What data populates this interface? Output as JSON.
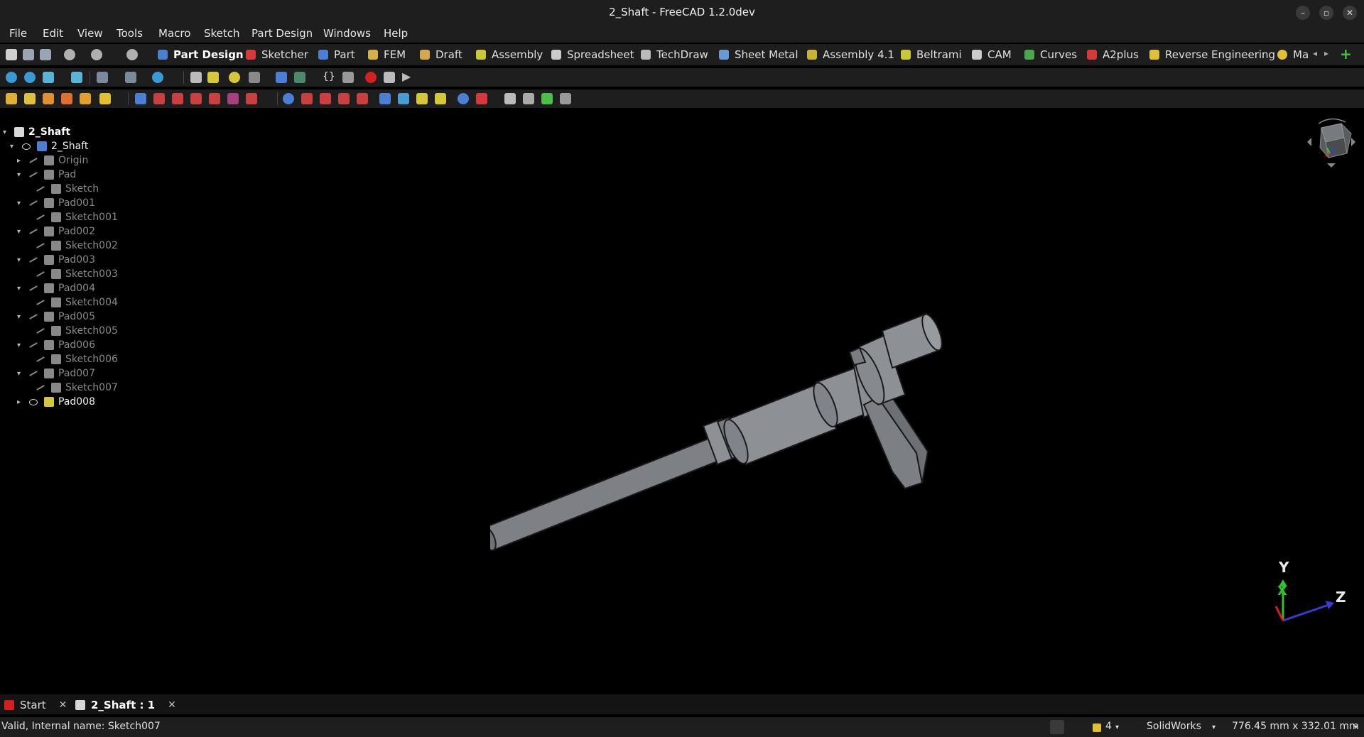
{
  "window": {
    "title": "2_Shaft - FreeCAD 1.2.0dev",
    "controls": [
      "–",
      "▫",
      "✕"
    ]
  },
  "menu": [
    "File",
    "Edit",
    "View",
    "Tools",
    "Macro",
    "Sketch",
    "Part Design",
    "Windows",
    "Help"
  ],
  "workbenches": [
    {
      "label": "Part Design",
      "color": "#4a7fd4",
      "active": true
    },
    {
      "label": "Sketcher",
      "color": "#d63a3a"
    },
    {
      "label": "Part",
      "color": "#4a7fd4"
    },
    {
      "label": "FEM",
      "color": "#d4b24a"
    },
    {
      "label": "Draft",
      "color": "#d4a94a"
    },
    {
      "label": "Assembly",
      "color": "#c8c83a"
    },
    {
      "label": "Spreadsheet",
      "color": "#cccccc"
    },
    {
      "label": "TechDraw",
      "color": "#bbbbbb"
    },
    {
      "label": "Sheet Metal",
      "color": "#6a9ad4"
    },
    {
      "label": "Assembly 4.1",
      "color": "#c8b23a"
    },
    {
      "label": "Beltrami",
      "color": "#c8c83a"
    },
    {
      "label": "CAM",
      "color": "#cccccc"
    },
    {
      "label": "Curves",
      "color": "#4aa84a"
    },
    {
      "label": "A2plus",
      "color": "#d43a3a"
    },
    {
      "label": "Reverse Engineering",
      "color": "#e0c03a"
    },
    {
      "label": "Ma",
      "color": "#e0c03a"
    }
  ],
  "tree": {
    "root": "2_Shaft",
    "items": [
      {
        "label": "2_Shaft",
        "level": 1,
        "arrow": "▾",
        "eye": "shown",
        "icon": "body-icon",
        "color": "#4a7fd4",
        "style": "bright"
      },
      {
        "label": "Origin",
        "level": 2,
        "arrow": "▸",
        "eye": "hidden",
        "icon": "origin-icon",
        "color": "#888888",
        "style": "dim"
      },
      {
        "label": "Pad",
        "level": 2,
        "arrow": "▾",
        "eye": "hidden",
        "icon": "pad-icon",
        "color": "#888888",
        "style": "dim"
      },
      {
        "label": "Sketch",
        "level": 3,
        "arrow": "",
        "eye": "hidden",
        "icon": "sketch-icon",
        "color": "#888888",
        "style": "dim"
      },
      {
        "label": "Pad001",
        "level": 2,
        "arrow": "▾",
        "eye": "hidden",
        "icon": "pad-icon",
        "color": "#888888",
        "style": "dim"
      },
      {
        "label": "Sketch001",
        "level": 3,
        "arrow": "",
        "eye": "hidden",
        "icon": "sketch-icon",
        "color": "#888888",
        "style": "dim"
      },
      {
        "label": "Pad002",
        "level": 2,
        "arrow": "▾",
        "eye": "hidden",
        "icon": "pad-icon",
        "color": "#888888",
        "style": "dim"
      },
      {
        "label": "Sketch002",
        "level": 3,
        "arrow": "",
        "eye": "hidden",
        "icon": "sketch-icon",
        "color": "#888888",
        "style": "dim"
      },
      {
        "label": "Pad003",
        "level": 2,
        "arrow": "▾",
        "eye": "hidden",
        "icon": "pad-icon",
        "color": "#888888",
        "style": "dim"
      },
      {
        "label": "Sketch003",
        "level": 3,
        "arrow": "",
        "eye": "hidden",
        "icon": "sketch-icon",
        "color": "#888888",
        "style": "dim"
      },
      {
        "label": "Pad004",
        "level": 2,
        "arrow": "▾",
        "eye": "hidden",
        "icon": "pad-icon",
        "color": "#888888",
        "style": "dim"
      },
      {
        "label": "Sketch004",
        "level": 3,
        "arrow": "",
        "eye": "hidden",
        "icon": "sketch-icon",
        "color": "#888888",
        "style": "dim"
      },
      {
        "label": "Pad005",
        "level": 2,
        "arrow": "▾",
        "eye": "hidden",
        "icon": "pad-icon",
        "color": "#888888",
        "style": "dim"
      },
      {
        "label": "Sketch005",
        "level": 3,
        "arrow": "",
        "eye": "hidden",
        "icon": "sketch-icon",
        "color": "#888888",
        "style": "dim"
      },
      {
        "label": "Pad006",
        "level": 2,
        "arrow": "▾",
        "eye": "hidden",
        "icon": "pad-icon",
        "color": "#888888",
        "style": "dim"
      },
      {
        "label": "Sketch006",
        "level": 3,
        "arrow": "",
        "eye": "hidden",
        "icon": "sketch-icon",
        "color": "#888888",
        "style": "dim"
      },
      {
        "label": "Pad007",
        "level": 2,
        "arrow": "▾",
        "eye": "hidden",
        "icon": "pad-icon",
        "color": "#888888",
        "style": "dim"
      },
      {
        "label": "Sketch007",
        "level": 3,
        "arrow": "",
        "eye": "hidden",
        "icon": "sketch-icon",
        "color": "#888888",
        "style": "dim"
      },
      {
        "label": "Pad008",
        "level": 2,
        "arrow": "▸",
        "eye": "shown",
        "icon": "pad-tip-icon",
        "color": "#d4c83a",
        "style": "bright"
      }
    ]
  },
  "tabs": [
    {
      "label": "Start",
      "active": false
    },
    {
      "label": "2_Shaft : 1",
      "active": true
    }
  ],
  "status": {
    "message": "Valid, Internal name: Sketch007",
    "notifications": "4",
    "nav_style": "SolidWorks",
    "dimensions": "776.45 mm x 332.01 mm"
  },
  "axes": {
    "y": "Y",
    "x": "X",
    "z": "Z"
  },
  "colors": {
    "model": "#8d9196",
    "model_edge": "#1a1a1a",
    "background": "#000000"
  }
}
